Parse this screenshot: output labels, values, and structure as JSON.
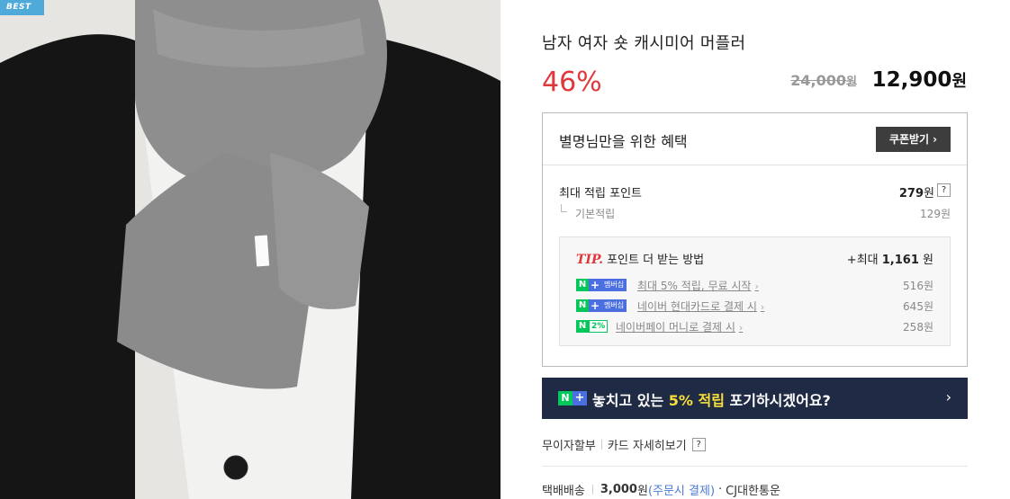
{
  "badge": "BEST",
  "product": {
    "title": "남자 여자 숏 캐시미어 머플러",
    "discount": "46%",
    "original_price": "24,000",
    "original_won": "원",
    "sale_price": "12,900",
    "sale_won": "원"
  },
  "benefit": {
    "title": "별명님만을 위한 혜택",
    "coupon_label": "쿠폰받기",
    "coupon_arrow": "›",
    "max_point_label": "최대 적립 포인트",
    "max_point_value": "279",
    "max_point_won": "원",
    "help": "?",
    "basic_label": "기본적립",
    "basic_value": "129원"
  },
  "tip": {
    "tip_word": "TIP.",
    "title": "포인트 더 받는 방법",
    "max_prefix": "+최대",
    "max_value": "1,161",
    "max_won": "원",
    "items": [
      {
        "badge_n": "N",
        "badge_plus": "+",
        "badge_text": "멤버십",
        "label": "최대 5% 적립, 무료 시작",
        "chev": "›",
        "value": "516원"
      },
      {
        "badge_n": "N",
        "badge_plus": "+",
        "badge_text": "멤버십",
        "label": "네이버 현대카드로 결제 시",
        "chev": "›",
        "value": "645원"
      },
      {
        "badge_n": "N",
        "badge_pct": "2%",
        "label": "네이버페이 머니로 결제 시",
        "chev": "›",
        "value": "258원"
      }
    ]
  },
  "banner": {
    "logo_n": "N",
    "logo_plus": "+",
    "text_before": "놓치고 있는 ",
    "highlight": "5% 적립",
    "text_after": " 포기하시겠어요?",
    "arrow": "›"
  },
  "payment": {
    "installment": "무이자할부",
    "card_detail": "카드 자세히보기",
    "help": "?"
  },
  "shipping": {
    "label": "택배배송",
    "fee": "3,000",
    "fee_won": "원",
    "when": "(주문시 결제)",
    "dot": "·",
    "carrier": "CJ대한통운"
  },
  "colors": {
    "discount_red": "#e0373a",
    "banner_bg": "#1f2a44",
    "banner_highlight": "#f7e03b",
    "naver_green": "#03c75a",
    "membership_blue": "#4b6ee0",
    "badge_blue": "#4fa9d9"
  }
}
